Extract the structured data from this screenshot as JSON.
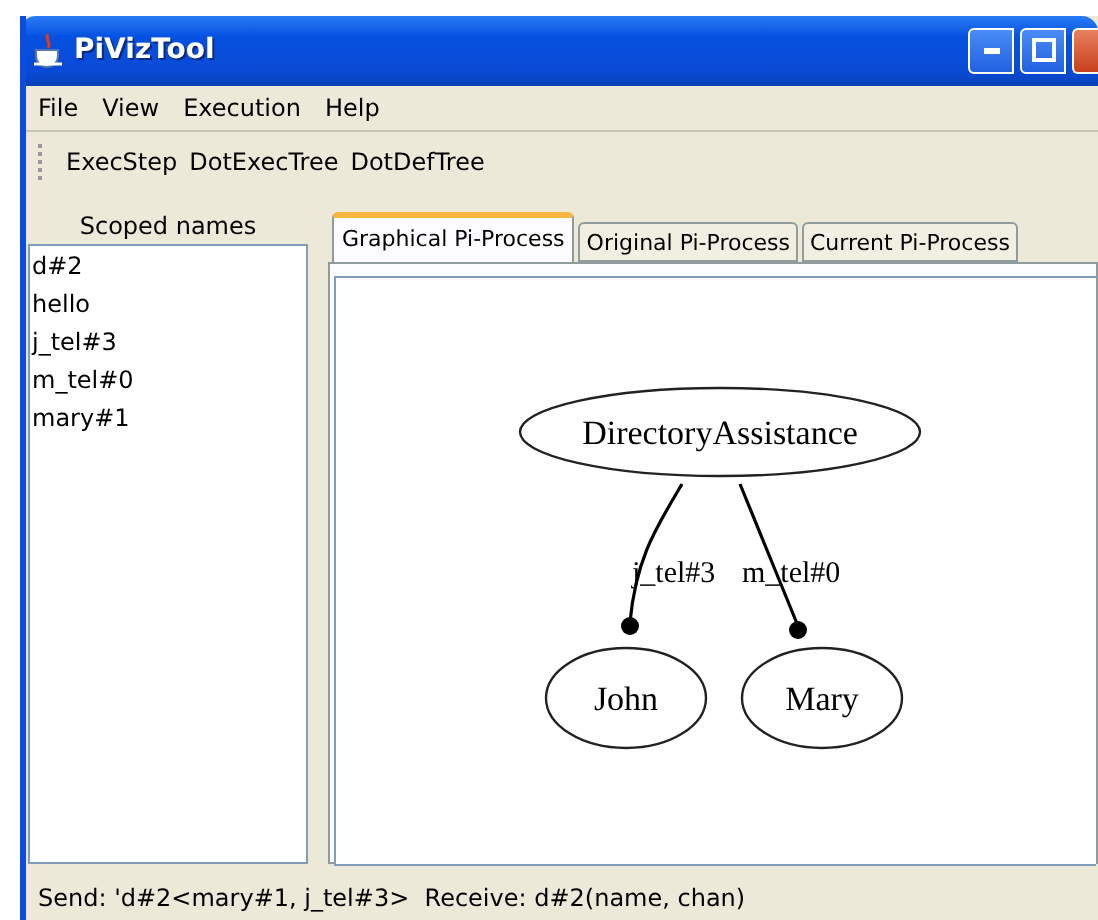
{
  "window": {
    "title": "PiVizTool"
  },
  "menu": [
    {
      "label": "File"
    },
    {
      "label": "View"
    },
    {
      "label": "Execution"
    },
    {
      "label": "Help"
    }
  ],
  "toolbar": [
    "ExecStep",
    "DotExecTree",
    "DotDefTree"
  ],
  "scoped_names": {
    "title": "Scoped names",
    "items": [
      "d#2",
      "hello",
      "j_tel#3",
      "m_tel#0",
      "mary#1"
    ]
  },
  "tabs": [
    {
      "label": "Graphical Pi-Process",
      "selected": true
    },
    {
      "label": "Original Pi-Process",
      "selected": false
    },
    {
      "label": "Current Pi-Process",
      "selected": false
    }
  ],
  "graph": {
    "nodes": [
      "DirectoryAssistance",
      "John",
      "Mary"
    ],
    "edges": [
      {
        "label": "j_tel#3"
      },
      {
        "label": "m_tel#0"
      }
    ]
  },
  "status_bar": "Send: 'd#2<mary#1, j_tel#3>  Receive: d#2(name, chan)"
}
